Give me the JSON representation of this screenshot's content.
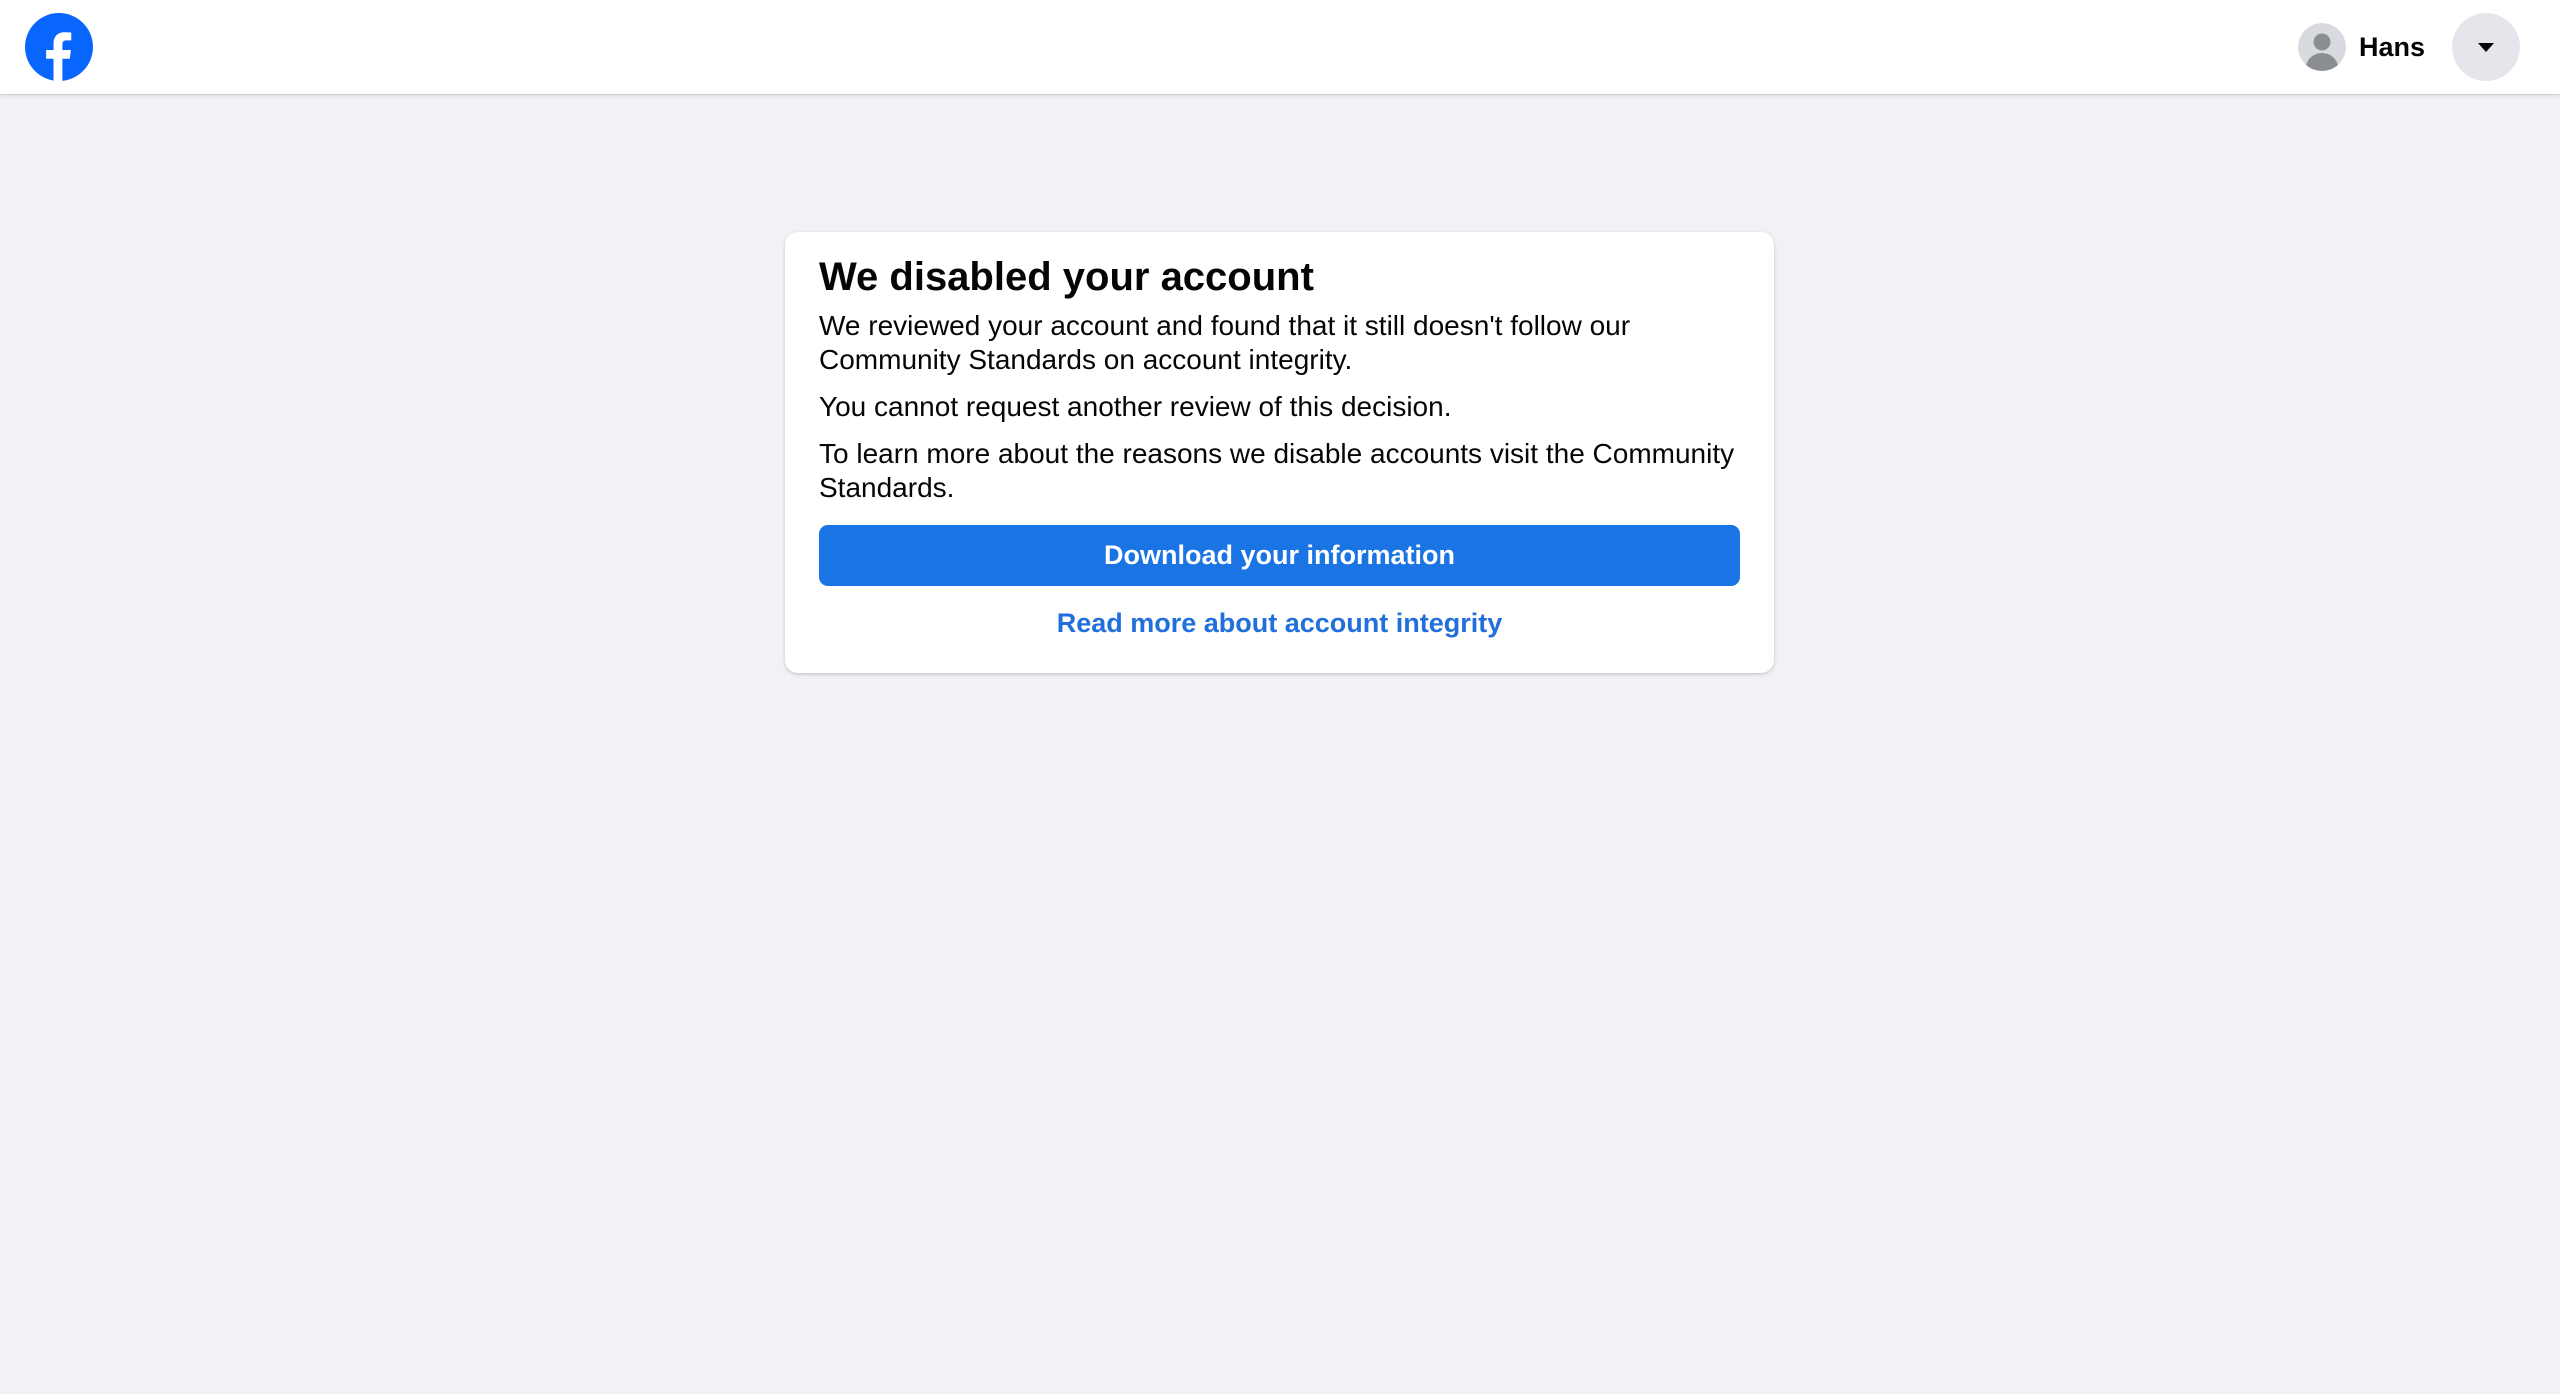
{
  "header": {
    "logo_icon": "facebook-logo-icon",
    "brand_color": "#0866ff",
    "user_name": "Hans",
    "avatar_icon": "default-avatar-icon",
    "menu_icon": "caret-down-icon"
  },
  "card": {
    "title": "We disabled your account",
    "paragraph_1": "We reviewed your account and found that it still doesn't follow our Community Standards on account integrity.",
    "paragraph_2": "You cannot request another review of this decision.",
    "paragraph_3": "To learn more about the reasons we disable accounts visit the Community Standards.",
    "primary_button_label": "Download your information",
    "primary_button_color": "#1b74e4",
    "link_label": "Read more about account integrity",
    "link_color": "#216fdb"
  }
}
